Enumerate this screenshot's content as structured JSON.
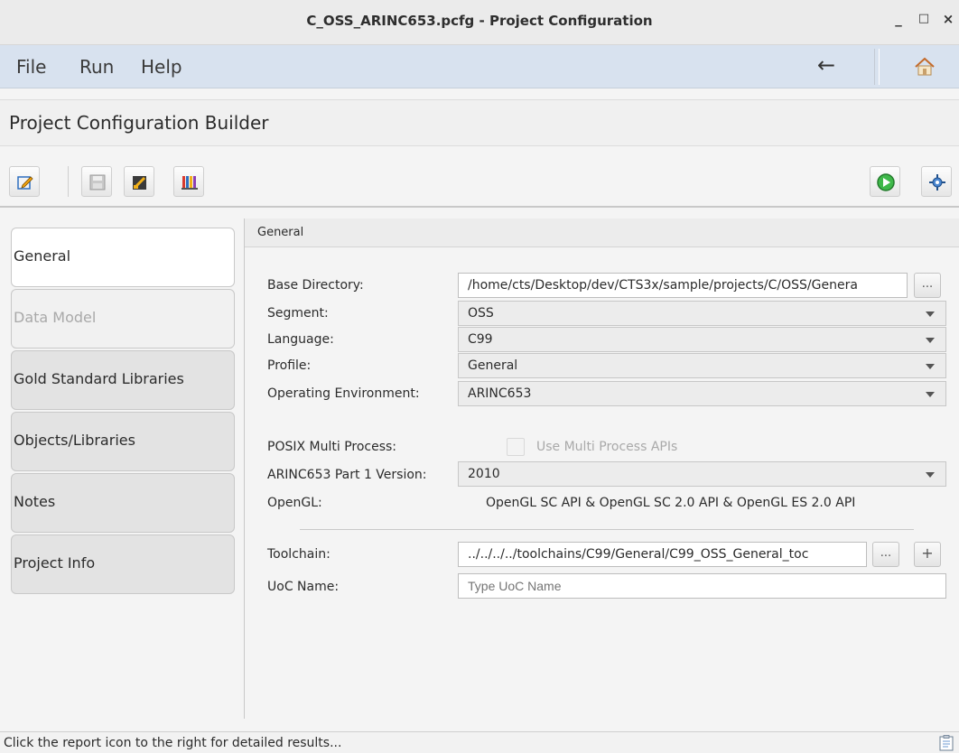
{
  "window": {
    "title": "C_OSS_ARINC653.pcfg - Project Configuration",
    "minimize": "_",
    "maximize": "□",
    "close": "×"
  },
  "menu": {
    "items": [
      "File",
      "Run",
      "Help"
    ],
    "back": "←",
    "home_icon": "home-icon"
  },
  "header": {
    "title": "Project Configuration Builder"
  },
  "toolbar": {
    "buttons": [
      "edit-icon",
      "save-icon",
      "clear-icon",
      "library-icon"
    ],
    "right_buttons": [
      "run-icon",
      "settings-icon"
    ]
  },
  "sidebar": {
    "tabs": [
      {
        "label": "General",
        "state": "active"
      },
      {
        "label": "Data Model",
        "state": "disabled"
      },
      {
        "label": "Gold Standard Libraries",
        "state": "normal"
      },
      {
        "label": "Objects/Libraries",
        "state": "normal"
      },
      {
        "label": "Notes",
        "state": "normal"
      },
      {
        "label": "Project Info",
        "state": "normal"
      }
    ]
  },
  "panel": {
    "title": "General",
    "base_directory": {
      "label": "Base Directory:",
      "value": "/home/cts/Desktop/dev/CTS3x/sample/projects/C/OSS/Genera",
      "browse": "..."
    },
    "segment": {
      "label": "Segment:",
      "value": "OSS"
    },
    "language": {
      "label": "Language:",
      "value": "C99"
    },
    "profile": {
      "label": "Profile:",
      "value": "General"
    },
    "operating_environment": {
      "label": "Operating Environment:",
      "value": "ARINC653"
    },
    "posix": {
      "label": "POSIX Multi Process:",
      "checkbox_label": "Use Multi Process APIs"
    },
    "arinc_version": {
      "label": "ARINC653 Part 1 Version:",
      "value": "2010"
    },
    "opengl": {
      "label": "OpenGL:",
      "value": "OpenGL SC API & OpenGL SC 2.0 API & OpenGL ES 2.0 API"
    },
    "toolchain": {
      "label": "Toolchain:",
      "value": "../../../../toolchains/C99/General/C99_OSS_General_toc",
      "browse": "...",
      "add": "+"
    },
    "uoc_name": {
      "label": "UoC Name:",
      "placeholder": "Type UoC Name"
    }
  },
  "status": {
    "text": "Click the report icon to the right for detailed results..."
  }
}
